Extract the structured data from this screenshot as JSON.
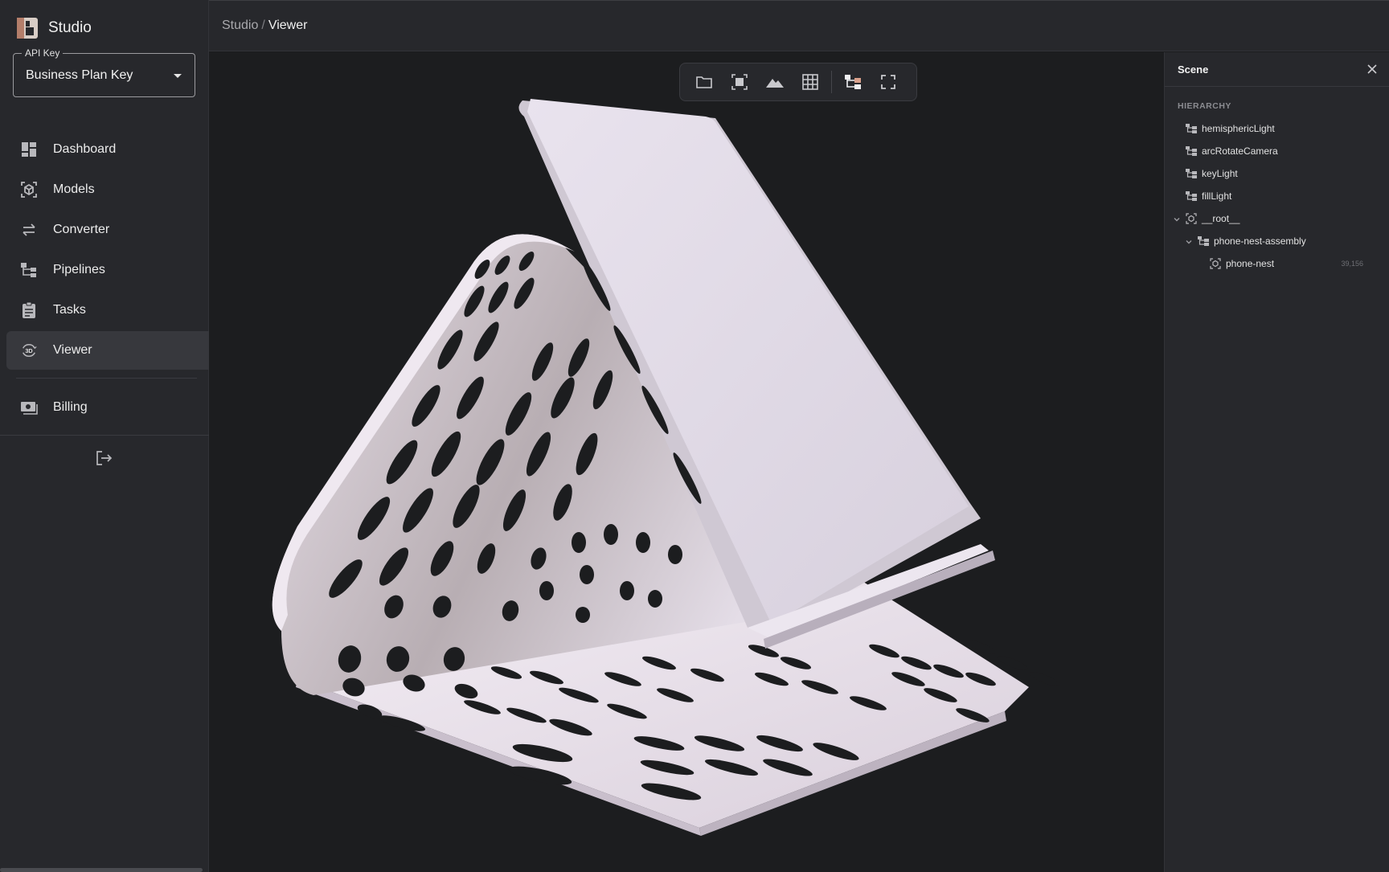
{
  "brand": {
    "name": "Studio"
  },
  "api_key": {
    "label": "API Key",
    "value": "Business Plan Key"
  },
  "nav": [
    {
      "label": "Dashboard",
      "icon": "dashboard-icon",
      "active": false
    },
    {
      "label": "Models",
      "icon": "models-icon",
      "active": false
    },
    {
      "label": "Converter",
      "icon": "converter-icon",
      "active": false
    },
    {
      "label": "Pipelines",
      "icon": "pipelines-icon",
      "active": false
    },
    {
      "label": "Tasks",
      "icon": "tasks-icon",
      "active": false
    },
    {
      "label": "Viewer",
      "icon": "viewer-3d-icon",
      "active": true
    },
    {
      "label": "Billing",
      "icon": "billing-icon",
      "active": false
    }
  ],
  "viewer_icon_text": "3D",
  "breadcrumb": {
    "root": "Studio",
    "separator": "/",
    "current": "Viewer"
  },
  "toolbar": [
    "folder-icon",
    "frame-icon",
    "terrain-icon",
    "grid-icon",
    "hierarchy-icon",
    "fullscreen-icon"
  ],
  "scene": {
    "title": "Scene",
    "section": "HIERARCHY",
    "items": [
      {
        "label": "hemisphericLight",
        "icon": "node-icon",
        "depth": 0,
        "expanded": null,
        "meta": ""
      },
      {
        "label": "arcRotateCamera",
        "icon": "node-icon",
        "depth": 0,
        "expanded": null,
        "meta": ""
      },
      {
        "label": "keyLight",
        "icon": "node-icon",
        "depth": 0,
        "expanded": null,
        "meta": ""
      },
      {
        "label": "fillLight",
        "icon": "node-icon",
        "depth": 0,
        "expanded": null,
        "meta": ""
      },
      {
        "label": "__root__",
        "icon": "mesh-icon",
        "depth": 0,
        "expanded": true,
        "meta": ""
      },
      {
        "label": "phone-nest-assembly",
        "icon": "node-icon",
        "depth": 1,
        "expanded": true,
        "meta": ""
      },
      {
        "label": "phone-nest",
        "icon": "mesh-icon",
        "depth": 2,
        "expanded": null,
        "meta": "39,156"
      }
    ]
  },
  "colors": {
    "background": "#1c1d1f",
    "panel": "#27282c",
    "active": "#37383d",
    "accent": "#d9a08b",
    "model": "#e6dde8"
  }
}
